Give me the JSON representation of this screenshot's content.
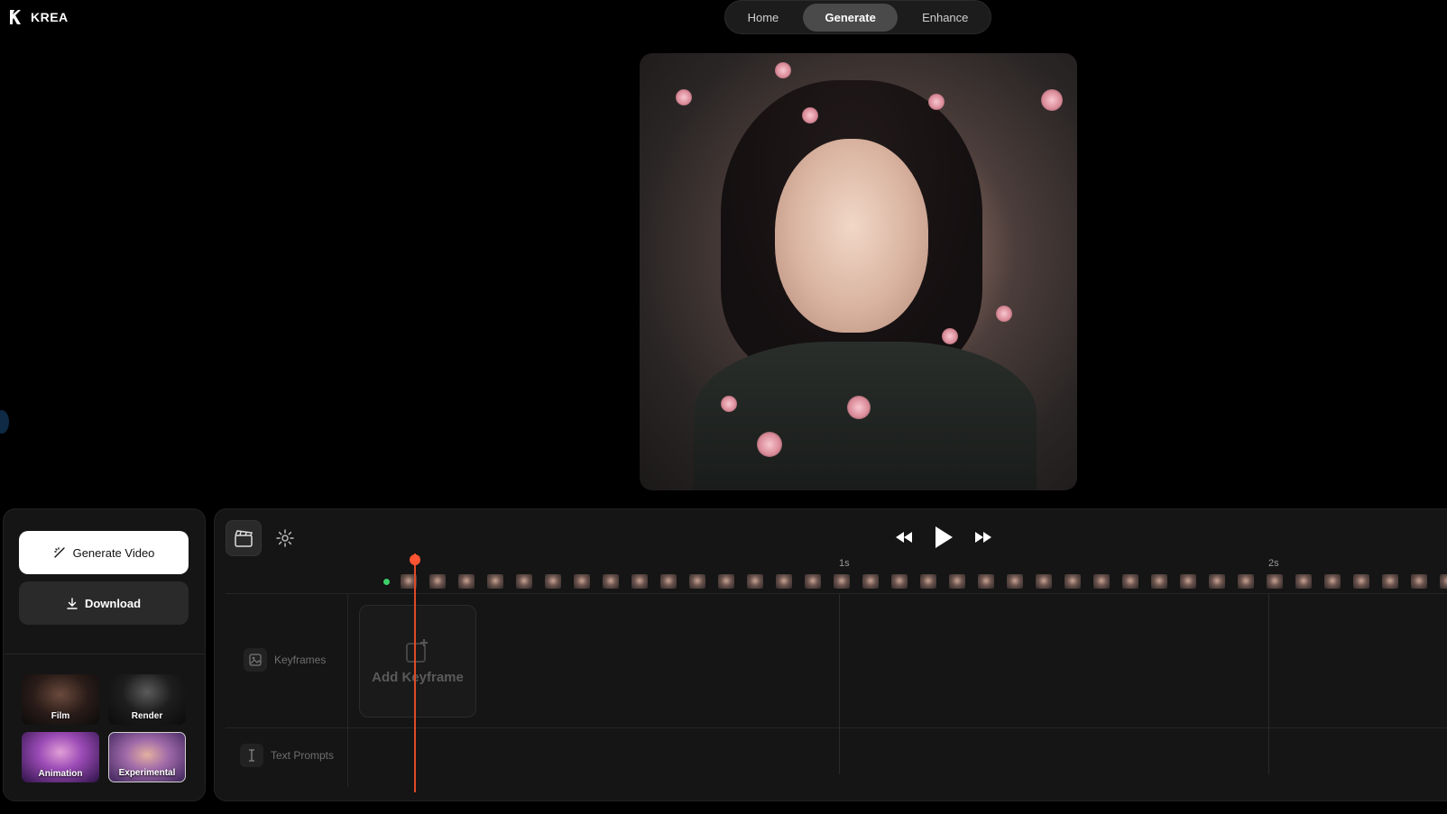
{
  "header": {
    "logo_text": "KREA",
    "nav": [
      {
        "label": "Home"
      },
      {
        "label": "Generate",
        "active": true
      },
      {
        "label": "Enhance"
      }
    ]
  },
  "sidebar": {
    "generate_label": "Generate Video",
    "download_label": "Download",
    "styles": [
      {
        "label": "Film"
      },
      {
        "label": "Render"
      },
      {
        "label": "Animation"
      },
      {
        "label": "Experimental",
        "selected": true
      }
    ]
  },
  "timeline": {
    "ruler": [
      "1s",
      "2s"
    ],
    "tracks": {
      "keyframes_label": "Keyframes",
      "text_prompts_label": "Text Prompts",
      "add_keyframe_label": "Add Keyframe"
    }
  },
  "colors": {
    "accent_playhead": "#ff5533",
    "start_marker": "#3ecf6a",
    "background": "#000000",
    "panel": "#151515"
  },
  "icons": [
    "logo-icon",
    "generate-icon",
    "download-icon",
    "clapper-icon",
    "gear-icon",
    "rewind-icon",
    "play-icon",
    "fast-forward-icon",
    "image-icon",
    "text-cursor-icon"
  ]
}
